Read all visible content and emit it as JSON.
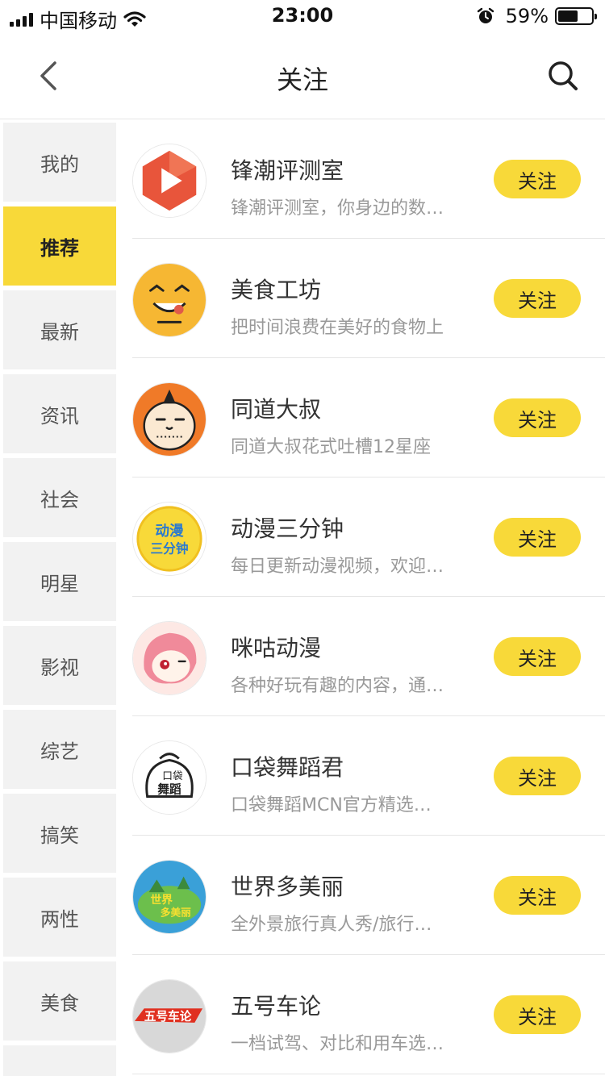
{
  "status_bar": {
    "carrier": "中国移动",
    "time": "23:00",
    "battery": "59%",
    "battery_level": 0.59,
    "icons": [
      "signal-icon",
      "wifi-icon",
      "alarm-icon",
      "battery-icon"
    ]
  },
  "nav": {
    "title": "关注",
    "back_icon": "chevron-left-icon",
    "search_icon": "search-icon"
  },
  "sidebar": {
    "active_index": 1,
    "items": [
      {
        "label": "我的"
      },
      {
        "label": "推荐"
      },
      {
        "label": "最新"
      },
      {
        "label": "资讯"
      },
      {
        "label": "社会"
      },
      {
        "label": "明星"
      },
      {
        "label": "影视"
      },
      {
        "label": "综艺"
      },
      {
        "label": "搞笑"
      },
      {
        "label": "两性"
      },
      {
        "label": "美食"
      }
    ]
  },
  "accounts": [
    {
      "name": "锋潮评测室",
      "desc": "锋潮评测室，你身边的数…",
      "button": "关注"
    },
    {
      "name": "美食工坊",
      "desc": "把时间浪费在美好的食物上",
      "button": "关注"
    },
    {
      "name": "同道大叔",
      "desc": "同道大叔花式吐槽12星座",
      "button": "关注"
    },
    {
      "name": "动漫三分钟",
      "desc": "每日更新动漫视频，欢迎…",
      "button": "关注",
      "logo_lines": [
        "动漫",
        "三分钟"
      ]
    },
    {
      "name": "咪咕动漫",
      "desc": "各种好玩有趣的内容，通…",
      "button": "关注"
    },
    {
      "name": "口袋舞蹈君",
      "desc": "口袋舞蹈MCN官方精选…",
      "button": "关注",
      "logo_lines": [
        "口袋",
        "舞蹈"
      ]
    },
    {
      "name": "世界多美丽",
      "desc": "全外景旅行真人秀/旅行…",
      "button": "关注",
      "logo_lines": [
        "世界",
        "多美丽"
      ]
    },
    {
      "name": "五号车论",
      "desc": "一档试驾、对比和用车选…",
      "button": "关注",
      "logo_lines": [
        "五号车论"
      ]
    }
  ],
  "colors": {
    "accent": "#f8d939",
    "sidebar_bg": "#f2f2f2",
    "text_primary": "#333333",
    "text_secondary": "#999999"
  }
}
